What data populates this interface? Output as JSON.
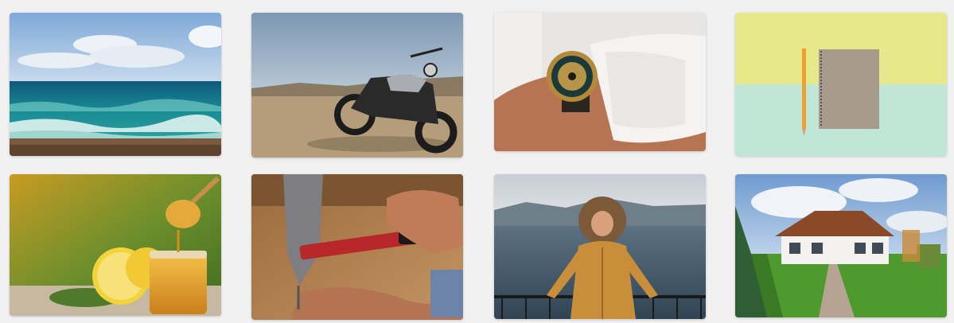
{
  "heading": "",
  "colors": {
    "background": "#f1f1f2",
    "heading": "#222222"
  },
  "tiles": [
    {
      "name": "ocean-waves-photo",
      "icon": "photo-ocean"
    },
    {
      "name": "motorcycle-photo",
      "icon": "photo-motorcycle"
    },
    {
      "name": "wristwatch-photo",
      "icon": "photo-watch"
    },
    {
      "name": "notebook-pencil-photo",
      "icon": "photo-notebook"
    },
    {
      "name": "honey-lemon-photo",
      "icon": "photo-honey"
    },
    {
      "name": "hammer-nail-photo",
      "icon": "photo-hammer"
    },
    {
      "name": "woman-lake-photo",
      "icon": "photo-lake"
    },
    {
      "name": "house-lawn-photo",
      "icon": "photo-house"
    }
  ]
}
